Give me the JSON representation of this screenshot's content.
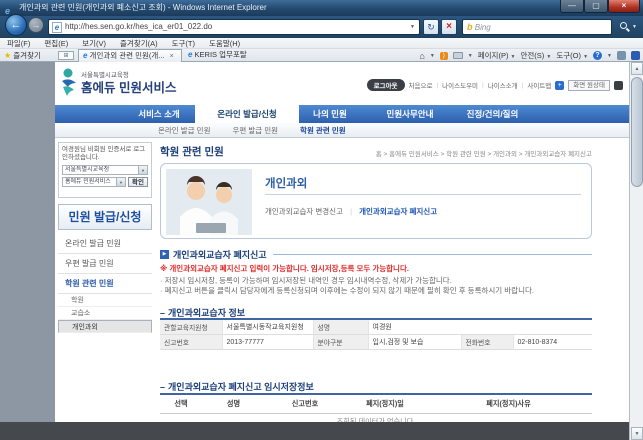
{
  "window": {
    "title": "개인과외 관련 민원(개인과외 폐소신고 조회) - Windows Internet Explorer"
  },
  "browser": {
    "url": "http://hes.sen.go.kr/hes_ica_er01_022.do",
    "search_engine": "Bing",
    "search_logo_letter": "b",
    "menu_items": [
      "파일(F)",
      "편집(E)",
      "보기(V)",
      "즐겨찾기(A)",
      "도구(T)",
      "도움말(H)"
    ],
    "favorites_button": "즐겨찾기",
    "tab_active": "개인과외 관련 민원(개...",
    "tab_inactive": "KERIS 업무포탈",
    "cmd_page": "페이지(P)",
    "cmd_safety": "안전(S)",
    "cmd_tools": "도구(O)"
  },
  "header": {
    "org": "서울특별시교육청",
    "service": "홈에듀 민원서비스",
    "logout": "로그아웃",
    "util_links": [
      "처음으로",
      "나이스도우미",
      "나이스소개",
      "사이트맵"
    ],
    "screen_reset": "화면 원상태"
  },
  "nav": {
    "items": [
      "서비스 소개",
      "온라인 발급/신청",
      "나의 민원",
      "민원사무안내",
      "진정/건의/질의"
    ],
    "sub_items": [
      "온라인 발급 민원",
      "우편 발급 민원",
      "학원 관련 민원"
    ]
  },
  "sidebar": {
    "login_message": "여경원님 비회원 인증서로 로그인하셨습니다.",
    "select_org": "서울특별시교육청",
    "select_service": "홈에듀 민원서비스",
    "confirm_button": "확인",
    "title": "민원 발급/신청",
    "menu": [
      "온라인 발급 민원",
      "우편 발급 민원",
      "학원 관련 민원"
    ],
    "submenu": [
      "학원",
      "교습소",
      "개인과외"
    ]
  },
  "main": {
    "page_title": "학원 관련 민원",
    "breadcrumb": "홈 > 홈에듀 민원서비스 > 학원 관련 민원 > 개인과외 > 개인과외교습자 폐지신고",
    "intro": {
      "title": "개인과외",
      "link_change": "개인과외교습자 변경신고",
      "link_close": "개인과외교습자 폐지신고"
    },
    "section_report_title": "개인과외교습자 폐지신고",
    "notice": "※ 개인과외교습자 폐지신고 입력이 가능합니다. 임시저장,등록 모두 가능합니다.",
    "note1": "저장시 임시저장, 등록이 가능하며 임시저장된 내역인 경우 임시내역수정, 삭제가 가능합니다.",
    "note2": "폐지신고 버튼을 클릭시 담당자에게 등록신청되며 이후에는 수정이 되지 않기 때문에 필히 확인 후 등록하시기 바랍니다.",
    "section_info_title": "개인과외교습자 정보",
    "info": {
      "r1c1_label": "관할교육지원청",
      "r1c1_value": "서울특별시동작교육지원청",
      "r1c2_label": "성명",
      "r1c2_value": "여경원",
      "r2c1_label": "신고번호",
      "r2c1_value": "2013-77777",
      "r2c2_label": "분야구분",
      "r2c2_value": "입시,검정 및 보습",
      "r2c3_label": "전화번호",
      "r2c3_value": "02-810-8374"
    },
    "section_saved_title": "개인과외교습자 폐지신고 임시저장정보",
    "saved_headers": [
      "선택",
      "성명",
      "신고번호",
      "폐지(정지)일",
      "폐지(정지)사유"
    ],
    "saved_empty": "조회된 데이터가 없습니다."
  },
  "colors": {
    "nav_blue": "#2d5fae",
    "title_navy": "#1c3f7a",
    "notice_red": "#e02a2a",
    "logout_dark": "#3a3f46"
  }
}
